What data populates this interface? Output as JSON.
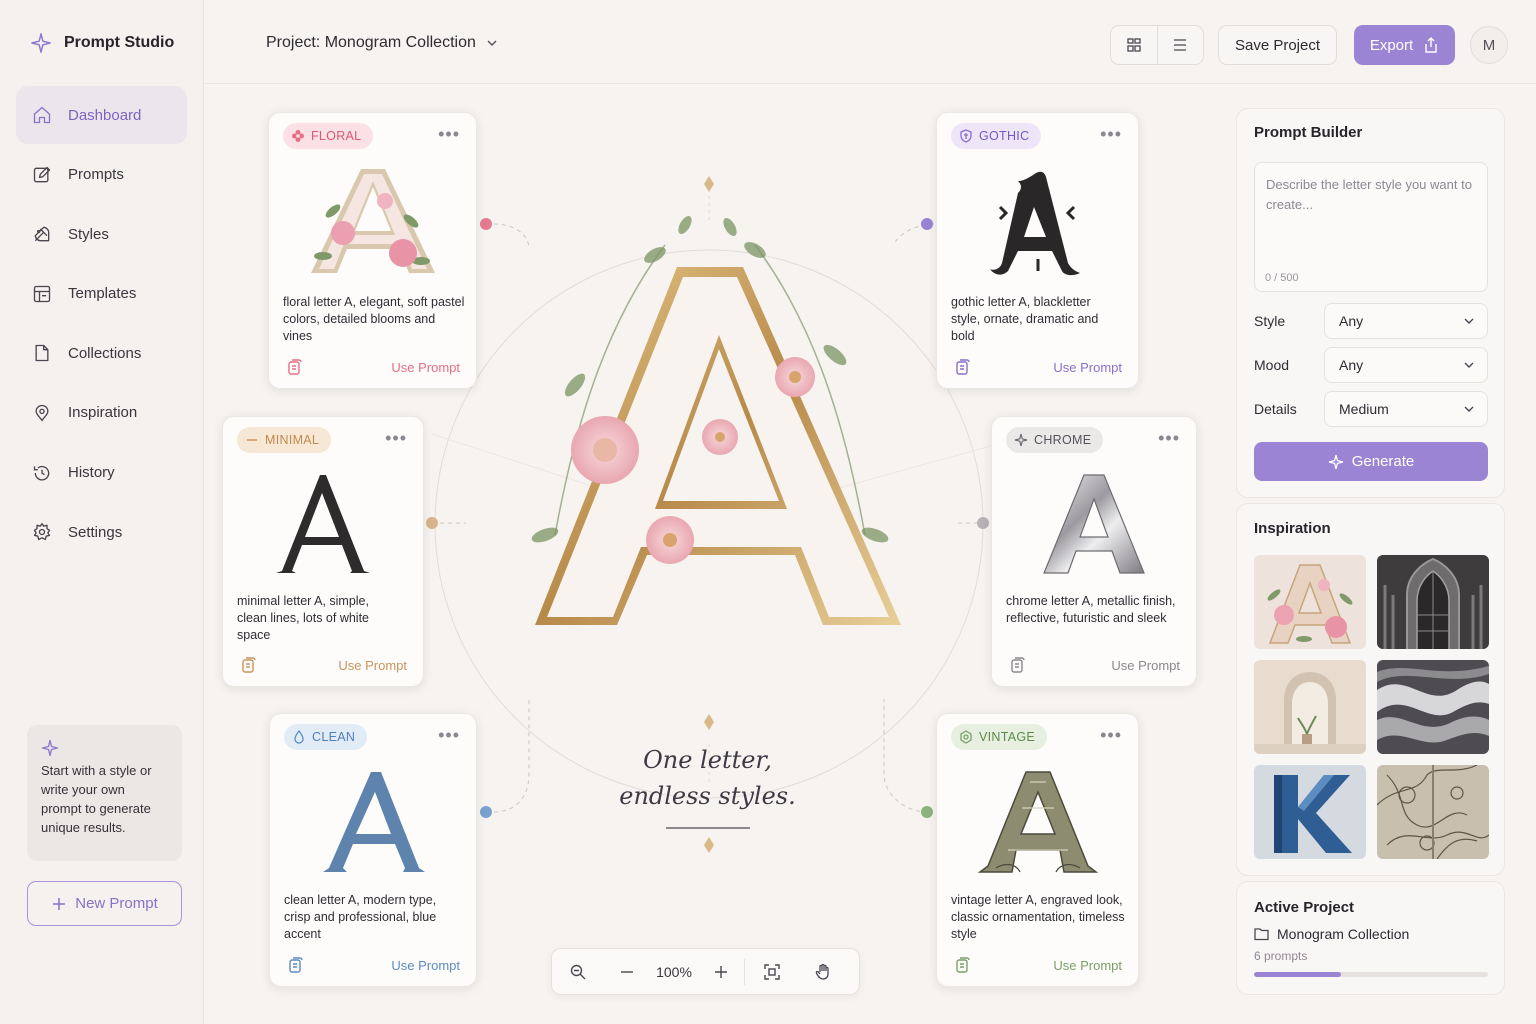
{
  "app": {
    "name": "Prompt Studio"
  },
  "sidebar": {
    "items": [
      {
        "label": "Dashboard",
        "icon": "home-icon",
        "active": true
      },
      {
        "label": "Prompts",
        "icon": "edit-icon"
      },
      {
        "label": "Styles",
        "icon": "palette-icon"
      },
      {
        "label": "Templates",
        "icon": "template-icon"
      },
      {
        "label": "Collections",
        "icon": "folder-icon"
      },
      {
        "label": "Inspiration",
        "icon": "lightbulb-icon"
      },
      {
        "label": "History",
        "icon": "history-icon"
      },
      {
        "label": "Settings",
        "icon": "gear-icon"
      }
    ],
    "tip": "Start with a style or write your own prompt to generate unique results.",
    "new_prompt_label": "New Prompt"
  },
  "header": {
    "project_title": "Project: Monogram Collection",
    "save_label": "Save Project",
    "export_label": "Export",
    "avatar_initial": "M"
  },
  "cards": [
    {
      "tag": "FLORAL",
      "description": "floral letter A, elegant, soft pastel colors, detailed blooms and vines",
      "action": "Use Prompt",
      "accent": "#e56f86"
    },
    {
      "tag": "GOTHIC",
      "description": "gothic letter A, blackletter style, ornate, dramatic and bold",
      "action": "Use Prompt",
      "accent": "#8a6fcf"
    },
    {
      "tag": "MINIMAL",
      "description": "minimal letter A, simple, clean lines, lots of white space",
      "action": "Use Prompt",
      "accent": "#c8955d"
    },
    {
      "tag": "CHROME",
      "description": "chrome letter A, metallic finish, reflective, futuristic and sleek",
      "action": "Use Prompt",
      "accent": "#8b878d"
    },
    {
      "tag": "CLEAN",
      "description": "clean letter A, modern type, crisp and professional, blue accent",
      "action": "Use Prompt",
      "accent": "#5a8bc4"
    },
    {
      "tag": "VINTAGE",
      "description": "vintage letter A, engraved look, classic ornamentation, timeless style",
      "action": "Use Prompt",
      "accent": "#7aa068"
    }
  ],
  "center": {
    "letter": "A",
    "tagline_line1": "One letter,",
    "tagline_line2": "endless styles."
  },
  "zoom": {
    "value": "100%"
  },
  "prompt_builder": {
    "title": "Prompt Builder",
    "placeholder": "Describe the letter style you want to create...",
    "counter": "0 / 500",
    "fields": [
      {
        "label": "Style",
        "value": "Any"
      },
      {
        "label": "Mood",
        "value": "Any"
      },
      {
        "label": "Details",
        "value": "Medium"
      }
    ],
    "generate_label": "Generate"
  },
  "inspiration": {
    "title": "Inspiration",
    "thumbs": [
      "floral-letter",
      "gothic-arch",
      "arched-alcove",
      "silver-waves",
      "blue-letter-k",
      "engraved-pattern"
    ]
  },
  "active_project": {
    "title": "Active Project",
    "name": "Monogram Collection",
    "count": "6 prompts",
    "progress": 0.37
  },
  "colors": {
    "accent": "#9b84d3",
    "background": "#f6f3f0"
  }
}
